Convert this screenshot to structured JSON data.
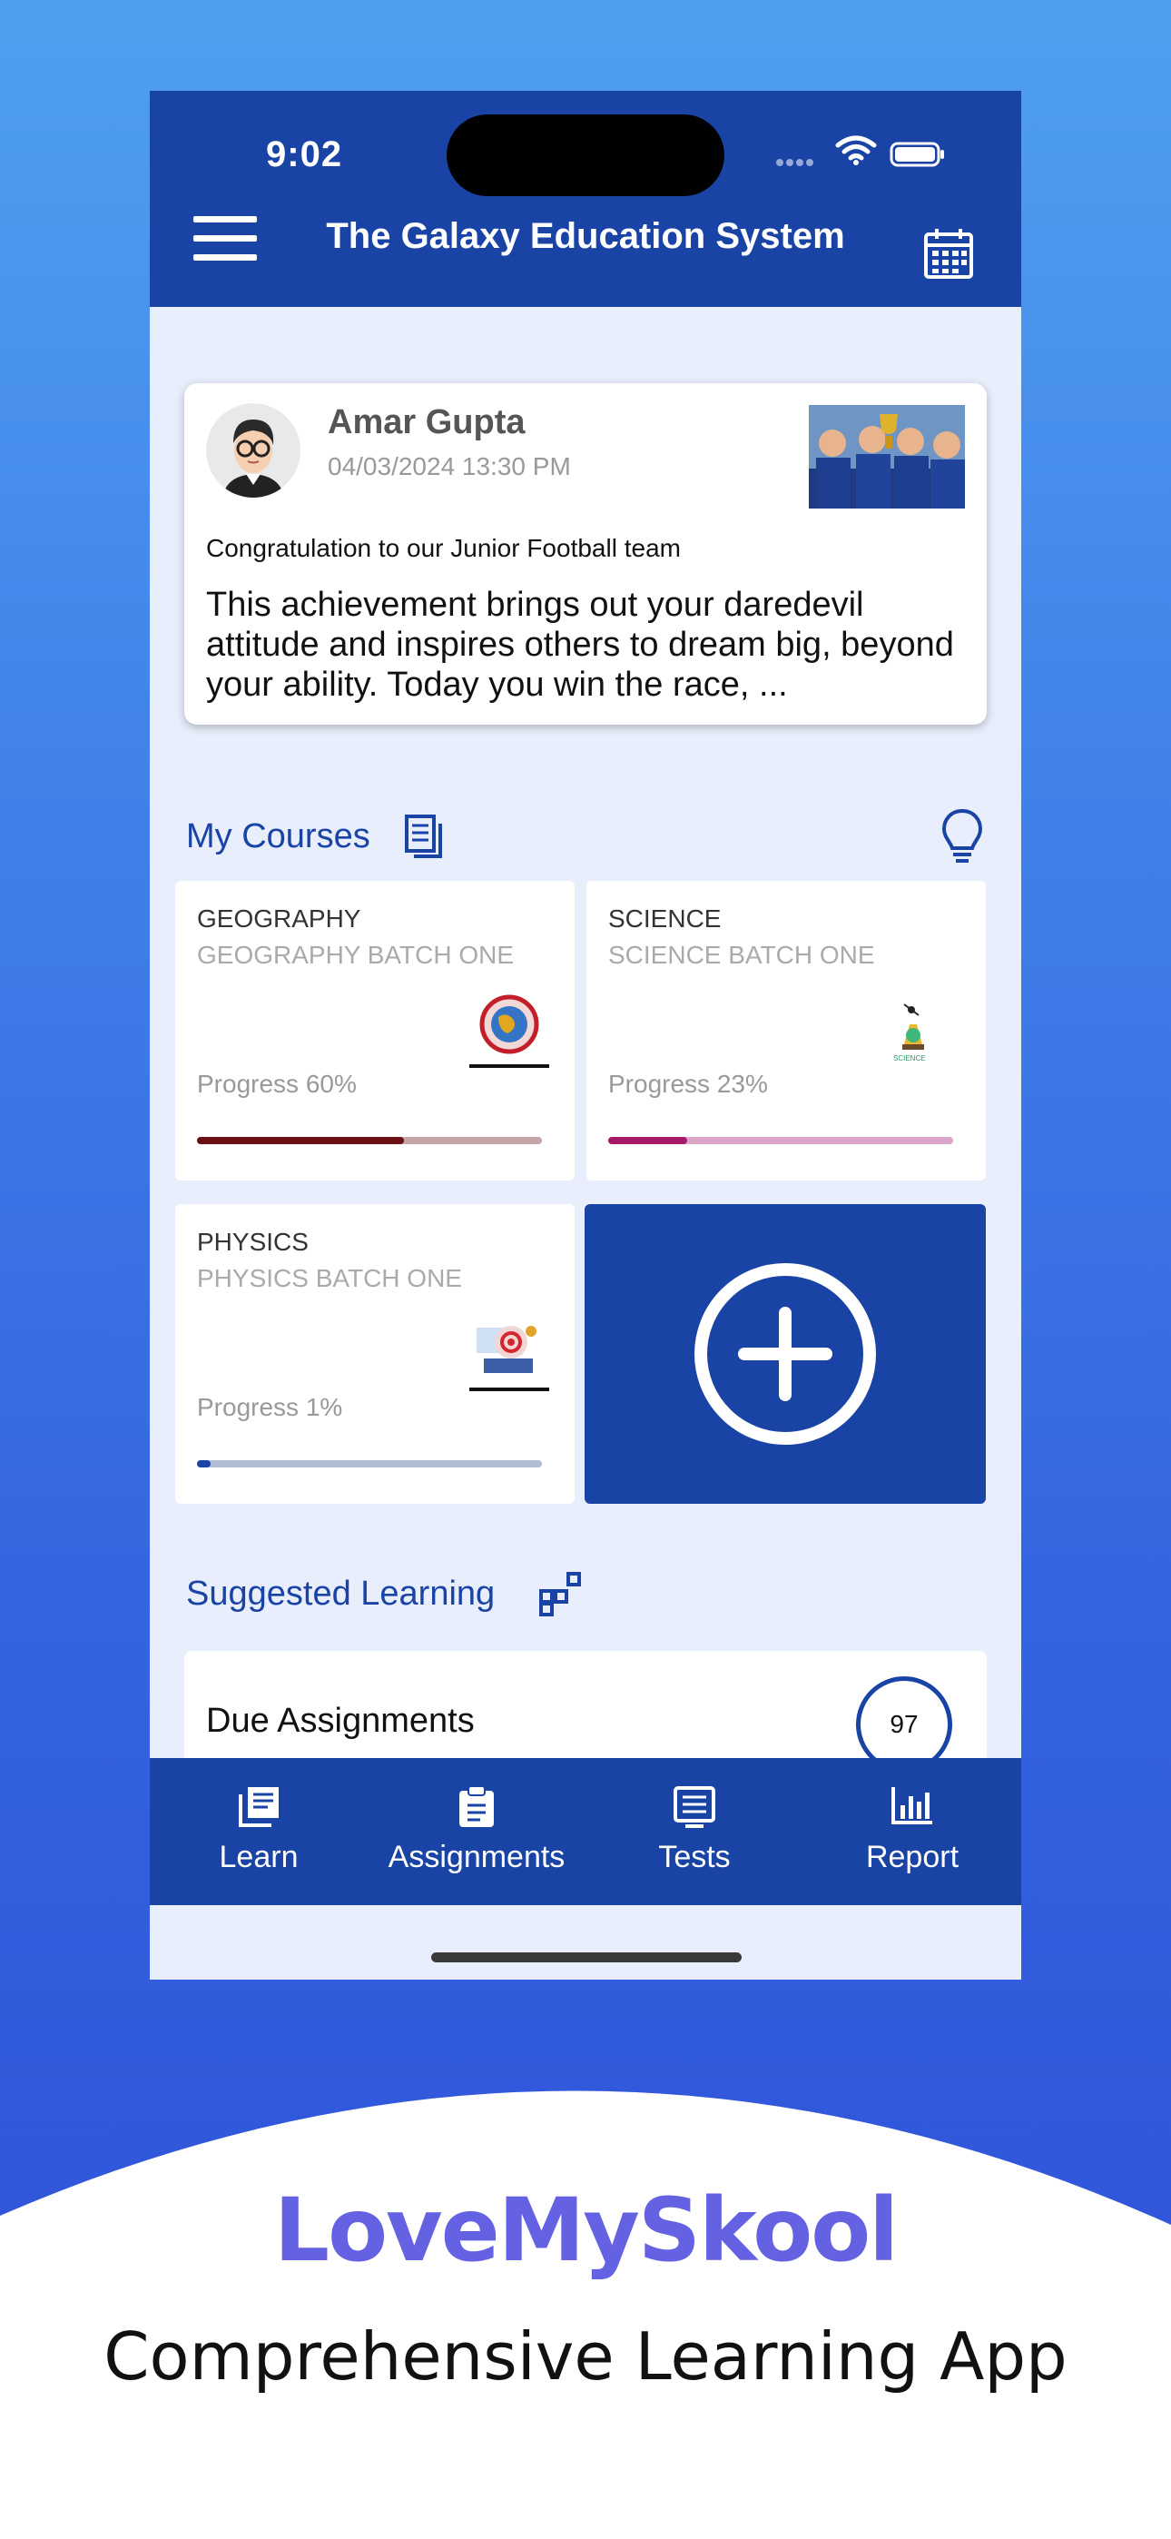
{
  "status_bar": {
    "time": "9:02"
  },
  "app_bar": {
    "title": "The Galaxy Education System",
    "menu_icon": "menu-icon",
    "calendar_icon": "calendar-icon"
  },
  "post": {
    "author": "Amar Gupta",
    "date": "04/03/2024 13:30 PM",
    "headline": "Congratulation to our Junior Football team",
    "body": "This achievement brings out your daredevil attitude and inspires others to dream big, beyond your ability. Today you win the race, ..."
  },
  "courses_section": {
    "title": "My Courses",
    "title_icon": "document-icon",
    "action_icon": "lightbulb-icon"
  },
  "courses": [
    {
      "name": "GEOGRAPHY",
      "batch": "GEOGRAPHY BATCH ONE",
      "progress_label": "Progress 60%",
      "progress": 0.6,
      "fill_color": "#6b0f12",
      "track_color": "#c4a4a4"
    },
    {
      "name": "SCIENCE",
      "batch": "SCIENCE BATCH ONE",
      "progress_label": "Progress 23%",
      "progress": 0.23,
      "fill_color": "#a5196b",
      "track_color": "#dca6c9"
    },
    {
      "name": "PHYSICS",
      "batch": "PHYSICS BATCH ONE",
      "progress_label": "Progress 1%",
      "progress": 0.01,
      "fill_color": "#1a43a6",
      "track_color": "#b0bdd2"
    }
  ],
  "add_course": {
    "icon": "plus-circle-icon"
  },
  "suggested": {
    "title": "Suggested Learning",
    "title_icon": "blocks-icon"
  },
  "due_assignments": {
    "label": "Due Assignments",
    "count": "97"
  },
  "bottom_nav": [
    {
      "label": "Learn",
      "icon": "book-icon"
    },
    {
      "label": "Assignments",
      "icon": "clipboard-icon"
    },
    {
      "label": "Tests",
      "icon": "list-icon"
    },
    {
      "label": "Report",
      "icon": "bar-chart-icon"
    }
  ],
  "promo": {
    "brand": "LoveMySkool",
    "tagline": "Comprehensive Learning App"
  },
  "colors": {
    "primary": "#1a43a6",
    "brand_purple": "#6461e3",
    "page_background": "#e8eefb"
  }
}
